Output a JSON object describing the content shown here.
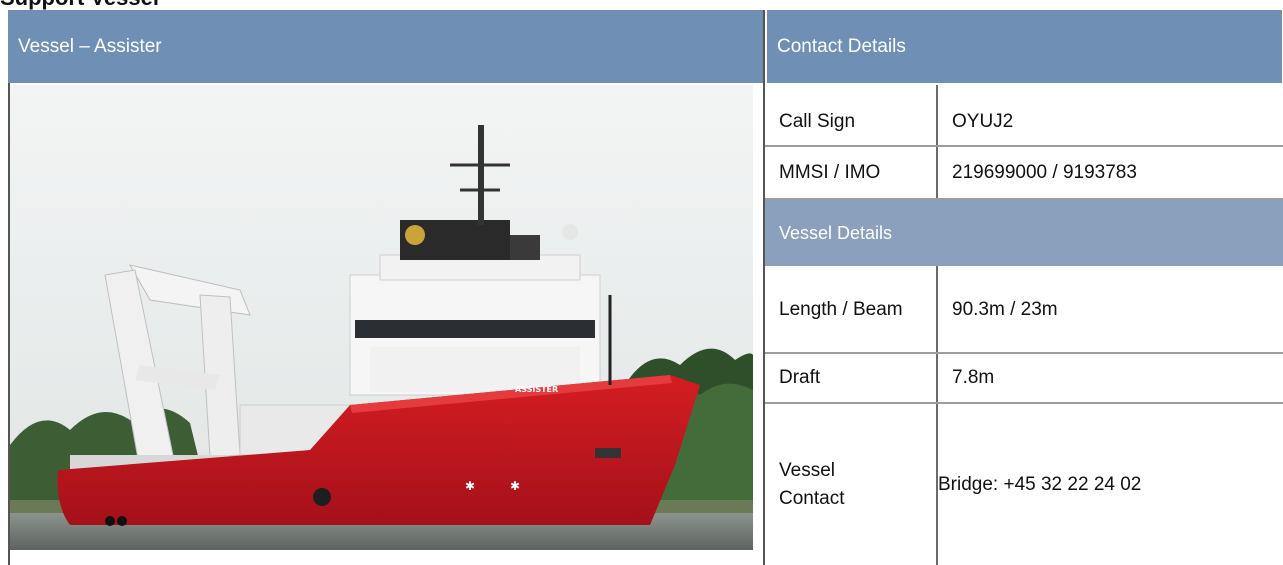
{
  "page": {
    "heading": "Support Vessel"
  },
  "left_panel": {
    "title": "Vessel – Assister",
    "photo": {
      "name_on_hull": "ASSISTER"
    }
  },
  "right_panel": {
    "title": "Contact Details",
    "rows": [
      {
        "label": "Call Sign",
        "value": "OYUJ2"
      },
      {
        "label": "MMSI / IMO",
        "value": "219699000 / 9193783"
      }
    ],
    "subheading": "Vessel Details",
    "details": [
      {
        "label": "Length / Beam",
        "value": "90.3m / 23m"
      },
      {
        "label": "Draft",
        "value": "7.8m"
      },
      {
        "label_line1": "Vessel",
        "label_line2": "Contact",
        "value": "Bridge: +45 32 22 24 02"
      }
    ]
  },
  "colors": {
    "header_blue": "#6f8fb5",
    "subheader_blue": "#8aa0bc",
    "hull_red": "#c8161c"
  }
}
